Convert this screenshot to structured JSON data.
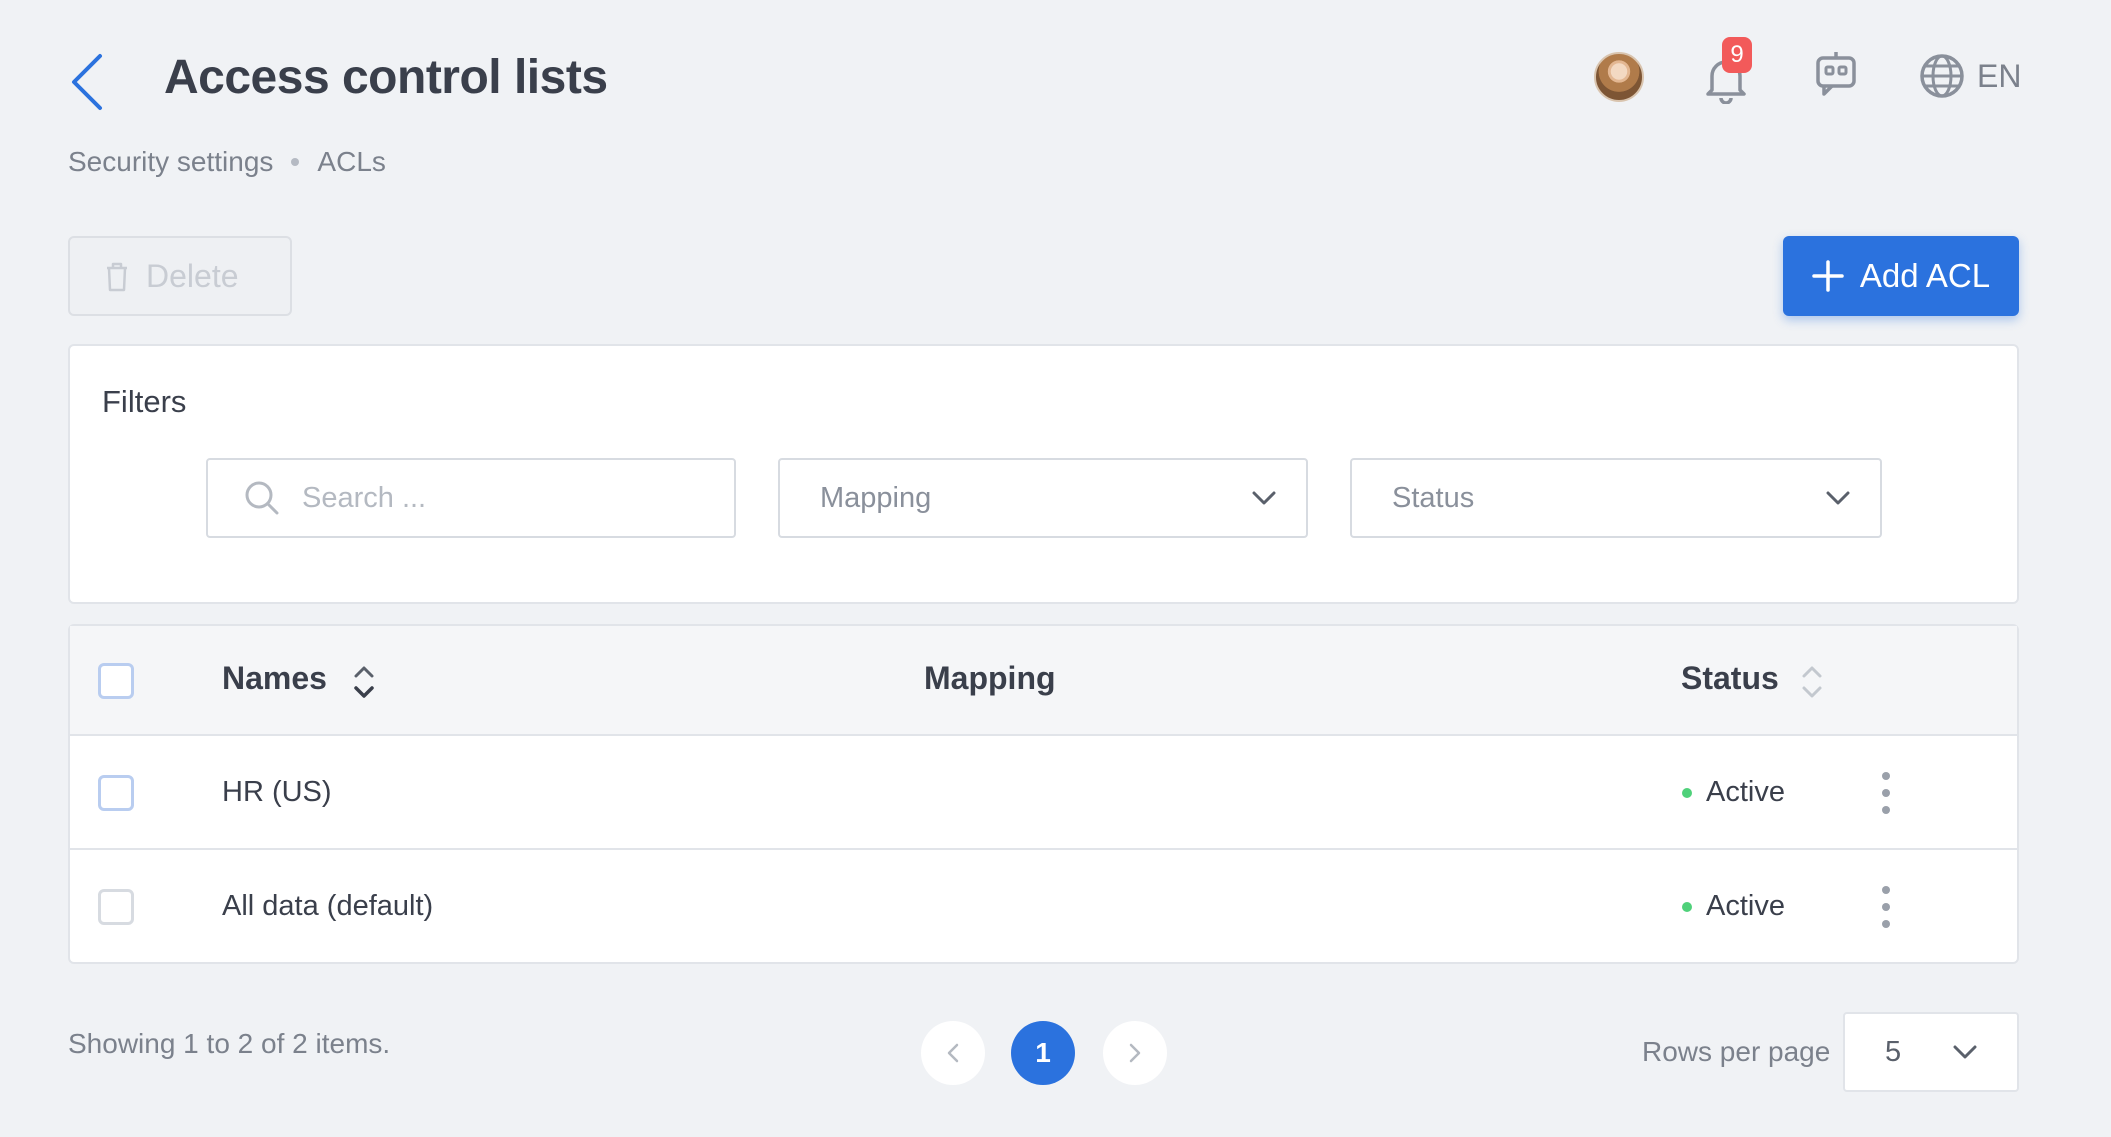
{
  "header": {
    "title": "Access control lists",
    "notification_count": "9",
    "language": "EN",
    "icons": [
      "chevron-left-icon",
      "avatar",
      "bell-icon",
      "robot-chat-icon",
      "globe-icon"
    ]
  },
  "breadcrumb": [
    "Security settings",
    "ACLs"
  ],
  "toolbar": {
    "delete_label": "Delete",
    "add_label": "Add ACL"
  },
  "filters": {
    "title": "Filters",
    "search_placeholder": "Search ...",
    "mapping_label": "Mapping",
    "status_label": "Status"
  },
  "table": {
    "columns": [
      "Names",
      "Mapping",
      "Status"
    ],
    "rows": [
      {
        "name": "HR (US)",
        "mapping": "",
        "status": "Active"
      },
      {
        "name": "All data (default)",
        "mapping": "",
        "status": "Active"
      }
    ]
  },
  "footer": {
    "showing": "Showing 1 to 2 of 2 items.",
    "current_page": "1",
    "rows_per_page_label": "Rows per page",
    "rows_per_page_value": "5"
  },
  "colors": {
    "accent": "#2b72de",
    "status_active": "#4fd17a",
    "badge": "#f25a5a",
    "background": "#f0f2f5"
  }
}
